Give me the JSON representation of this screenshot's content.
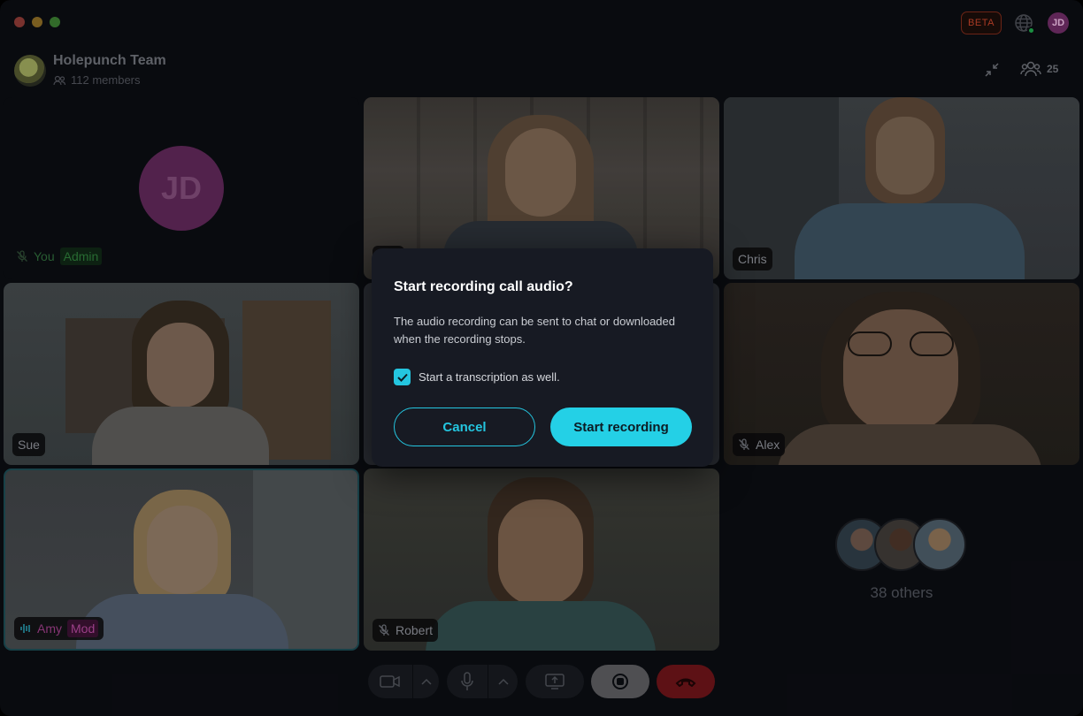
{
  "titlebar": {
    "beta_label": "BETA",
    "user_initials": "JD"
  },
  "header": {
    "group_name": "Holepunch Team",
    "members_text": "112 members",
    "participants_count": "25"
  },
  "self_tile": {
    "initials": "JD",
    "you_label": "You",
    "role_badge": "Admin"
  },
  "participants": [
    {
      "name": "",
      "muted": false
    },
    {
      "name": "Chris",
      "muted": false
    },
    {
      "name": "Sue",
      "muted": false
    },
    {
      "name": "Alex",
      "muted": true
    },
    {
      "name": "Amy",
      "badge": "Mod",
      "speaking": true
    },
    {
      "name": "Robert",
      "muted": true
    }
  ],
  "others": {
    "label": "38 others"
  },
  "modal": {
    "title": "Start recording call audio?",
    "body": "The audio recording can be sent to chat or downloaded when the recording stops.",
    "checkbox_label": "Start a transcription as well.",
    "checkbox_checked": true,
    "cancel_label": "Cancel",
    "confirm_label": "Start recording"
  },
  "colors": {
    "accent": "#24d0e6",
    "end_call": "#6a1418",
    "admin_green": "#2e7a3a",
    "mod_pink": "#c0429e"
  },
  "toolbar": {
    "icons": [
      "camera-icon",
      "chevron-up-icon",
      "microphone-icon",
      "chevron-up-icon",
      "screen-share-icon",
      "record-stop-icon",
      "end-call-icon"
    ]
  }
}
